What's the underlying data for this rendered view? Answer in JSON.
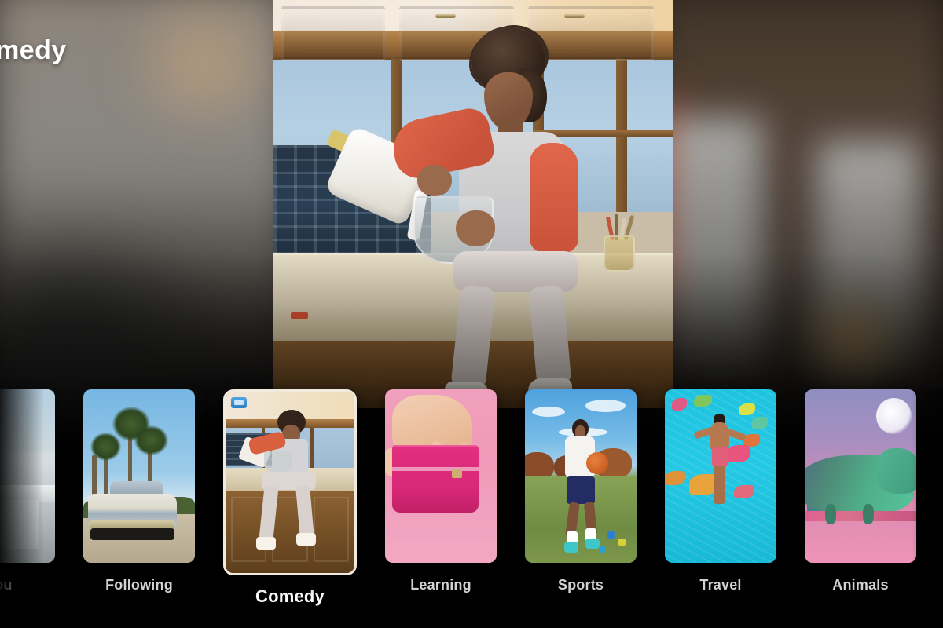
{
  "screen": {
    "title": "Comedy",
    "title_visible_text": "medy",
    "background_color": "#000000"
  },
  "hero": {
    "name": "hero-preview",
    "category": "Comedy",
    "description": "Person in kitchen pouring milk from a jug into a bowl while sitting on a counter"
  },
  "carousel": {
    "selected_index": 2,
    "cards": [
      {
        "label": "You",
        "art": "a-you",
        "selected": false,
        "clipped": "left",
        "description": "Person seated in an office with red object"
      },
      {
        "label": "Following",
        "art": "a-following",
        "selected": false,
        "description": "Classic car parked under palm trees"
      },
      {
        "label": "Comedy",
        "art": "a-comedy",
        "selected": true,
        "badge": "video-badge",
        "description": "Person pouring milk in a kitchen"
      },
      {
        "label": "Learning",
        "art": "a-learning",
        "selected": false,
        "description": "Hand opening a pink box on a pink background"
      },
      {
        "label": "Sports",
        "art": "a-sports",
        "selected": false,
        "description": "Player dribbling a basketball on a grass field"
      },
      {
        "label": "Travel",
        "art": "a-travel",
        "selected": false,
        "description": "Aerial view of a swimmer in turquoise water with fish"
      },
      {
        "label": "Animals",
        "art": "a-animals",
        "selected": false,
        "clipped": "right",
        "description": "Green chameleon on a branch against a pink purple sky"
      }
    ]
  },
  "colors": {
    "selected_border": "#efeadd",
    "label_default": "#d2d2d2",
    "label_selected": "#ffffff",
    "badge": "#2f7fc4"
  }
}
